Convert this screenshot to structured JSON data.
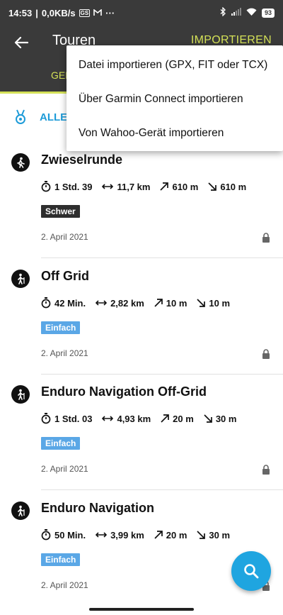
{
  "status_bar": {
    "time": "14:53",
    "net_speed": "0,0KB/s",
    "mini_badge": "GS",
    "more_dots": "···",
    "battery": "93"
  },
  "app_bar": {
    "title": "Touren",
    "import_label": "IMPORTIEREN",
    "active_tab_visible": "GEP",
    "accent_color": "#d4e157",
    "background_color": "#3a3a3a"
  },
  "filter": {
    "label": "ALLE"
  },
  "import_menu": {
    "items": [
      "Datei importieren (GPX, FIT oder TCX)",
      "Über Garmin Connect importieren",
      "Von Wahoo-Gerät importieren"
    ]
  },
  "tours": [
    {
      "name": "Zwieselrunde",
      "duration": "1 Std. 39",
      "distance": "11,7 km",
      "ascent": "610 m",
      "descent": "610 m",
      "difficulty": "Schwer",
      "difficulty_level": "hard",
      "date": "2. April 2021",
      "icon": "hiker-icon"
    },
    {
      "name": "Off Grid",
      "duration": "42 Min.",
      "distance": "2,82 km",
      "ascent": "10 m",
      "descent": "10 m",
      "difficulty": "Einfach",
      "difficulty_level": "easy",
      "date": "2. April 2021",
      "icon": "hiker-icon"
    },
    {
      "name": "Enduro Navigation Off-Grid",
      "duration": "1 Std. 03",
      "distance": "4,93 km",
      "ascent": "20 m",
      "descent": "30 m",
      "difficulty": "Einfach",
      "difficulty_level": "easy",
      "date": "2. April 2021",
      "icon": "hiker-icon"
    },
    {
      "name": "Enduro Navigation",
      "duration": "50 Min.",
      "distance": "3,99 km",
      "ascent": "20 m",
      "descent": "30 m",
      "difficulty": "Einfach",
      "difficulty_level": "easy",
      "date": "2. April 2021",
      "icon": "hiker-icon"
    }
  ],
  "fab": {
    "icon": "search-icon",
    "color": "#1fa5e0"
  }
}
